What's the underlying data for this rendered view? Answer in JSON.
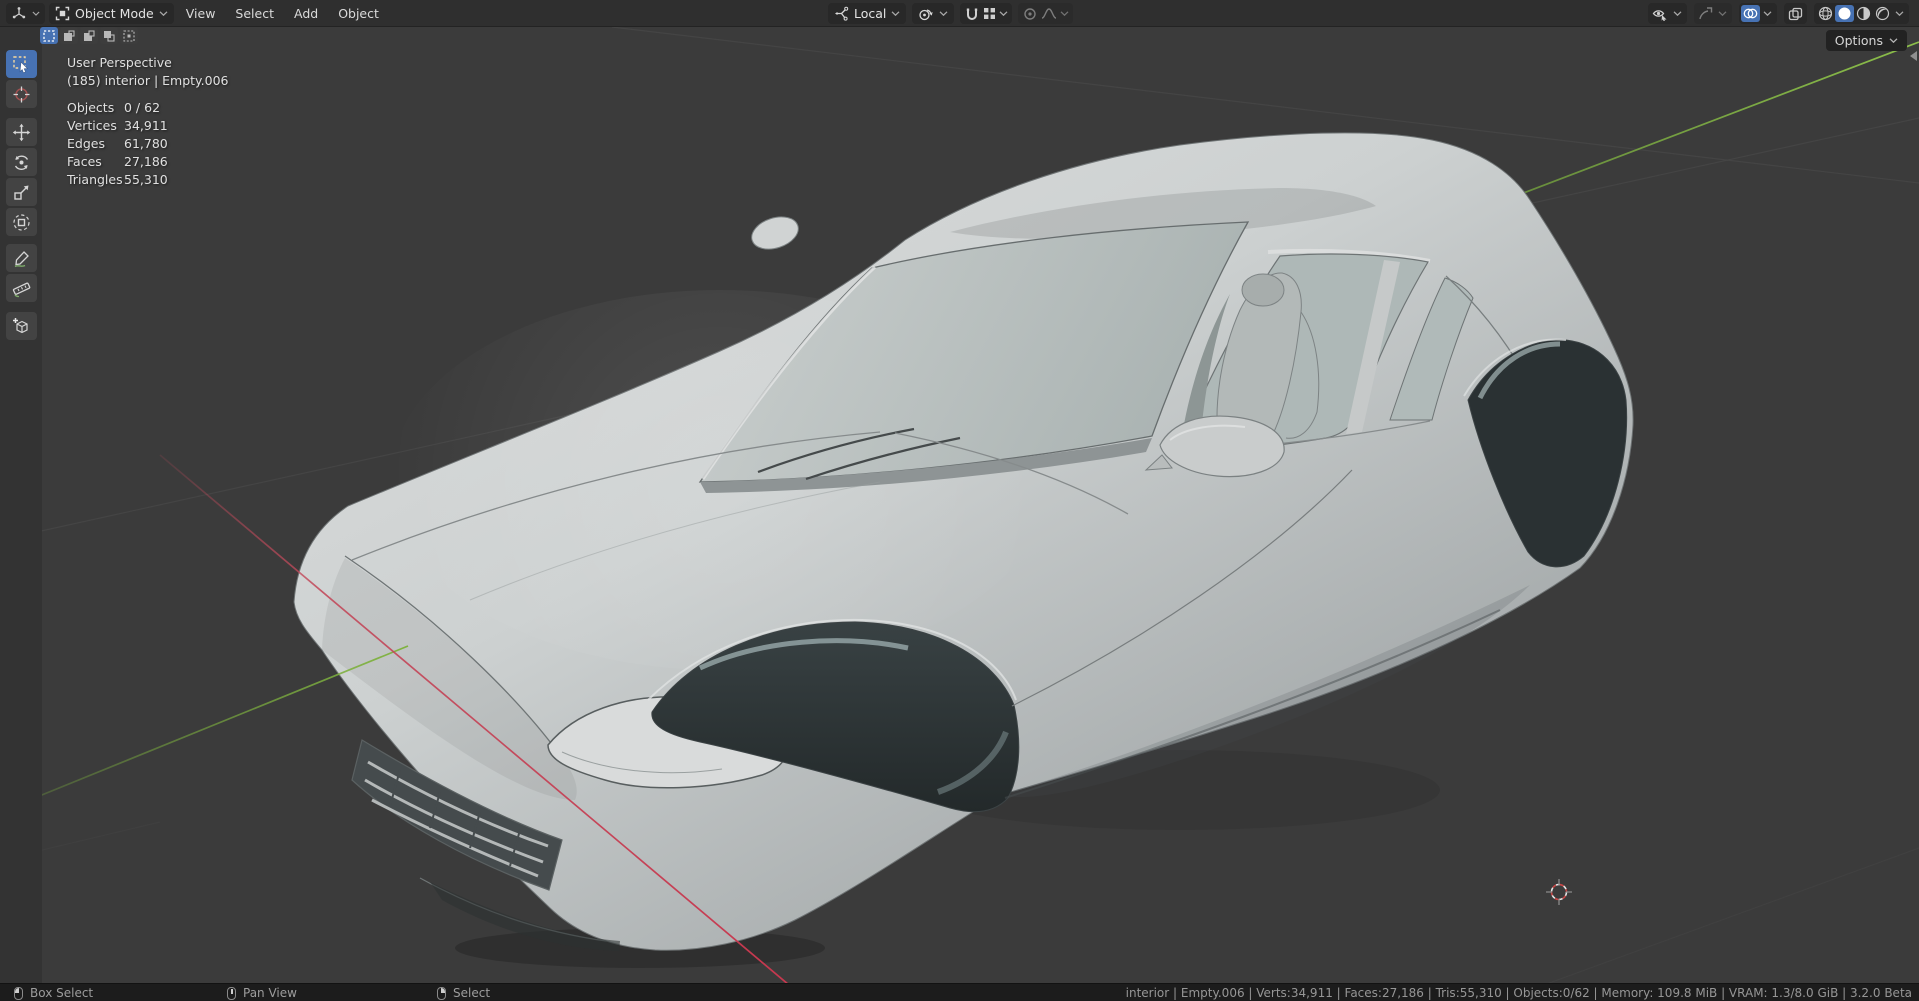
{
  "header": {
    "editor_icon": "editor-type-3d-viewport",
    "mode": "Object Mode",
    "menus": [
      {
        "label": "View"
      },
      {
        "label": "Select"
      },
      {
        "label": "Add"
      },
      {
        "label": "Object"
      }
    ],
    "transform_orientation": "Local",
    "center_icons": [
      "transform-orientation",
      "transform-pivot-point",
      "snap-magnet",
      "snap-target",
      "proportional-editing",
      "proportional-falloff"
    ],
    "right_icons": [
      "object-type-visibility",
      "viewport-gizmos",
      "viewport-overlays",
      "toggle-xray",
      "shading-wireframe",
      "shading-solid",
      "shading-material-preview",
      "shading-rendered"
    ],
    "overlays_enabled": true,
    "active_shading": "solid"
  },
  "tool_settings": {
    "select_modes": [
      "set",
      "extend",
      "subtract",
      "invert",
      "intersect"
    ],
    "active_select_mode": "set",
    "options_label": "Options"
  },
  "toolbar": {
    "tools": [
      {
        "name": "select-box",
        "active": true
      },
      {
        "name": "cursor",
        "active": false
      },
      {
        "name": "move",
        "active": false
      },
      {
        "name": "rotate",
        "active": false
      },
      {
        "name": "scale",
        "active": false
      },
      {
        "name": "transform",
        "active": false
      },
      {
        "name": "annotate",
        "active": false
      },
      {
        "name": "measure",
        "active": false
      },
      {
        "name": "add-cube",
        "active": false
      }
    ]
  },
  "viewport": {
    "view_label": "User Perspective",
    "context_label": "(185) interior | Empty.006",
    "stats": [
      {
        "label": "Objects",
        "value": "0 / 62"
      },
      {
        "label": "Vertices",
        "value": "34,911"
      },
      {
        "label": "Edges",
        "value": "61,780"
      },
      {
        "label": "Faces",
        "value": "27,186"
      },
      {
        "label": "Triangles",
        "value": "55,310"
      }
    ],
    "scene_object": "sports-car-body-mesh"
  },
  "status_bar": {
    "hints": [
      {
        "button": "left-mouse",
        "label": "Box Select"
      },
      {
        "button": "middle-mouse",
        "label": "Pan View"
      },
      {
        "button": "right-mouse",
        "label": "Select"
      }
    ],
    "info": "interior | Empty.006 | Verts:34,911 | Faces:27,186 | Tris:55,310 | Objects:0/62 | Memory: 109.8 MiB | VRAM: 1.3/8.0 GiB | 3.2.0 Beta"
  },
  "colors": {
    "accent": "#4772b3",
    "header_bg": "#2f2f2f",
    "viewport_bg": "#3b3b3b",
    "statusbar_bg": "#1c1c1c",
    "axis_x": "#c24a5b",
    "axis_y": "#74a43c",
    "car_body_light": "#d7d9d9",
    "car_body_shadow": "#a8adae"
  }
}
